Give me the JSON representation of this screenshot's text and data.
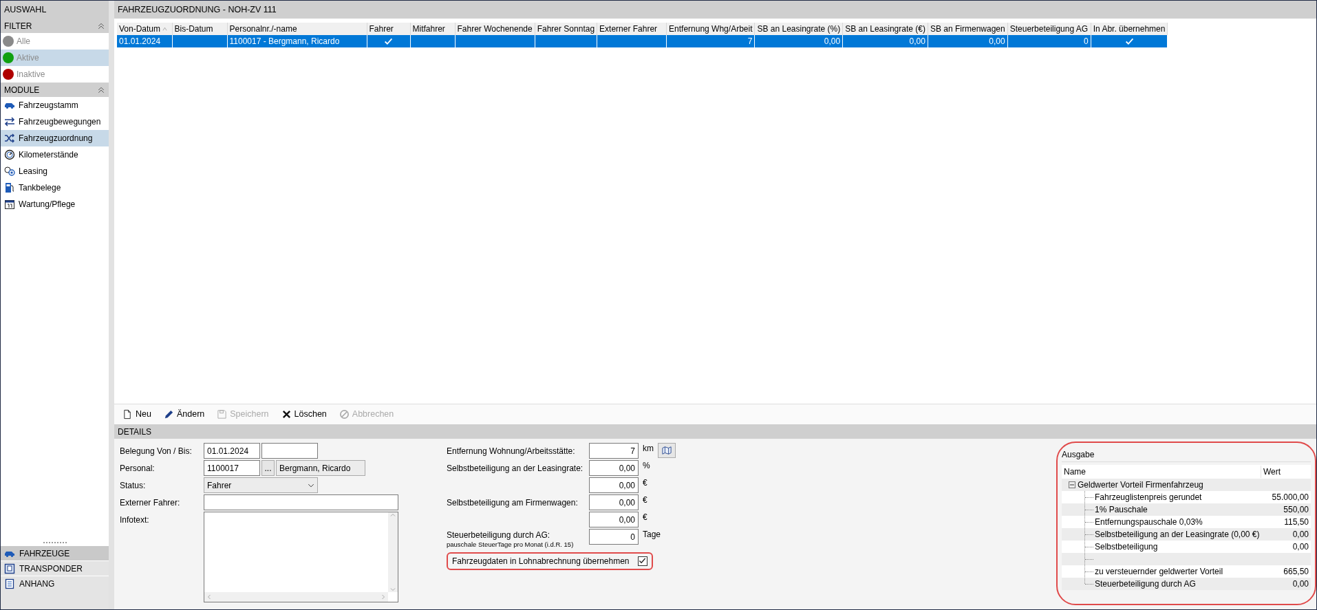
{
  "sidebar": {
    "title": "AUSWAHL",
    "filter": {
      "title": "FILTER",
      "items": [
        {
          "label": "Alle",
          "color": "#8a8a8a",
          "selected": false,
          "disabled": true
        },
        {
          "label": "Aktive",
          "color": "#10a010",
          "selected": true,
          "disabled": true
        },
        {
          "label": "Inaktive",
          "color": "#b00000",
          "selected": false,
          "disabled": true
        }
      ]
    },
    "modules": {
      "title": "MODULE",
      "items": [
        {
          "label": "Fahrzeugstamm",
          "kind": "car",
          "selected": false
        },
        {
          "label": "Fahrzeugbewegungen",
          "kind": "exchange",
          "selected": false
        },
        {
          "label": "Fahrzeugzuordnung",
          "kind": "shuffle",
          "selected": true
        },
        {
          "label": "Kilometerstände",
          "kind": "gauge",
          "selected": false
        },
        {
          "label": "Leasing",
          "kind": "coins",
          "selected": false
        },
        {
          "label": "Tankbelege",
          "kind": "fuel",
          "selected": false
        },
        {
          "label": "Wartung/Pflege",
          "kind": "calendar",
          "selected": false
        }
      ]
    },
    "sections": [
      {
        "label": "FAHRZEUGE",
        "kind": "car",
        "selected": true
      },
      {
        "label": "TRANSPONDER",
        "kind": "badge",
        "selected": false
      },
      {
        "label": "ANHANG",
        "kind": "document",
        "selected": false
      }
    ]
  },
  "main": {
    "title": "FAHRZEUGZUORDNUNG - NOH-ZV 111",
    "table": {
      "columns": [
        {
          "label": "Von-Datum",
          "sorted": true
        },
        {
          "label": "Bis-Datum",
          "sorted": false
        },
        {
          "label": "Personalnr./-name",
          "sorted": false
        },
        {
          "label": "Fahrer",
          "sorted": false
        },
        {
          "label": "Mitfahrer",
          "sorted": false
        },
        {
          "label": "Fahrer Wochenende",
          "sorted": false
        },
        {
          "label": "Fahrer Sonntag",
          "sorted": false
        },
        {
          "label": "Externer Fahrer",
          "sorted": false
        },
        {
          "label": "Entfernung Whg/Arbeit",
          "sorted": false
        },
        {
          "label": "SB an Leasingrate (%)",
          "sorted": false
        },
        {
          "label": "SB an Leasingrate (€)",
          "sorted": false
        },
        {
          "label": "SB an Firmenwagen",
          "sorted": false
        },
        {
          "label": "Steuerbeteiligung AG",
          "sorted": false
        },
        {
          "label": "In Abr. übernehmen",
          "sorted": false
        }
      ],
      "rows": [
        {
          "selected": true,
          "cells": [
            {
              "kind": "text",
              "text": "01.01.2024"
            },
            {
              "kind": "text"
            },
            {
              "kind": "text",
              "text": "1100017 - Bergmann, Ricardo"
            },
            {
              "kind": "check",
              "checked": true
            },
            {
              "kind": "check",
              "checked": false
            },
            {
              "kind": "check",
              "checked": false
            },
            {
              "kind": "check",
              "checked": false
            },
            {
              "kind": "check",
              "checked": false
            },
            {
              "kind": "number",
              "text": "7"
            },
            {
              "kind": "number",
              "text": "0,00"
            },
            {
              "kind": "number",
              "text": "0,00"
            },
            {
              "kind": "number",
              "text": "0,00"
            },
            {
              "kind": "number",
              "text": "0"
            },
            {
              "kind": "check",
              "checked": true
            }
          ]
        }
      ]
    },
    "toolbar": [
      {
        "label": "Neu",
        "kind": "new",
        "disabled": false
      },
      {
        "label": "Ändern",
        "kind": "edit",
        "disabled": false
      },
      {
        "label": "Speichern",
        "kind": "save",
        "disabled": true
      },
      {
        "label": "Löschen",
        "kind": "delete",
        "disabled": false
      },
      {
        "label": "Abbrechen",
        "kind": "cancel",
        "disabled": true
      }
    ],
    "details": {
      "title": "DETAILS",
      "belegung": {
        "label": "Belegung Von / Bis:",
        "from": "01.01.2024"
      },
      "personal": {
        "label": "Personal:",
        "number": "1100017",
        "browse": "...",
        "name": "Bergmann, Ricardo"
      },
      "status": {
        "label": "Status:",
        "value": "Fahrer"
      },
      "externer_fahrer": {
        "label": "Externer Fahrer:"
      },
      "infotext": {
        "label": "Infotext:"
      },
      "right_fields": [
        {
          "label": "Entfernung Wohnung/Arbeitsstätte:",
          "value": "7",
          "unit": "km",
          "map_button": true
        },
        {
          "label": "Selbstbeteiligung an der Leasingrate:",
          "value": "0,00",
          "unit": "%"
        },
        {
          "value": "0,00",
          "unit": "€"
        },
        {
          "label": "Selbstbeteiligung am Firmenwagen:",
          "value": "0,00",
          "unit": "€"
        },
        {
          "value": "0,00",
          "unit": "€"
        },
        {
          "label": "Steuerbeteiligung durch AG:",
          "note": "pauschale SteuerTage pro Monat (i.d.R. 15)",
          "value": "0",
          "unit": "Tage"
        }
      ],
      "checkbox": {
        "label": "Fahrzeugdaten in Lohnabrechnung übernehmen",
        "checked": true
      }
    },
    "ausgabe": {
      "title": "Ausgabe",
      "columns": [
        "Name",
        "Wert"
      ],
      "tree": [
        {
          "name": "Geldwerter Vorteil Firmenfahrzeug",
          "expanded": true,
          "children": [
            {
              "kind": "entry",
              "name": "Fahrzeuglistenpreis gerundet",
              "value": "55.000,00"
            },
            {
              "kind": "entry",
              "name": "1% Pauschale",
              "value": "550,00"
            },
            {
              "kind": "entry",
              "name": "Entfernungspauschale 0,03%",
              "value": "115,50"
            },
            {
              "kind": "entry",
              "name": "Selbstbeteiligung an der Leasingrate (0,00 €)",
              "value": "0,00"
            },
            {
              "kind": "entry",
              "name": "Selbstbeteiligung",
              "value": "0,00"
            },
            {
              "kind": "blank"
            },
            {
              "kind": "entry",
              "name": "zu versteuernder geldwerter Vorteil",
              "value": "665,50"
            },
            {
              "kind": "entry",
              "name": "Steuerbeteiligung durch AG",
              "value": "0,00"
            }
          ]
        }
      ]
    }
  }
}
